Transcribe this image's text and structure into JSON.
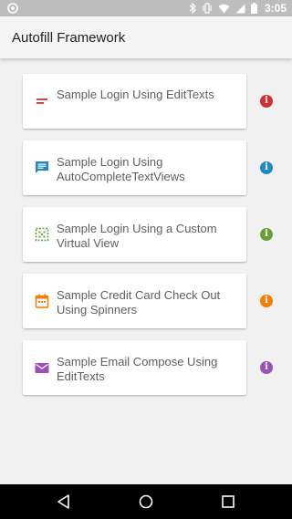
{
  "status": {
    "time": "3:05",
    "icons": [
      "bluetooth-icon",
      "vibrate-icon",
      "wifi-icon",
      "signal-icon",
      "battery-icon"
    ]
  },
  "app_bar": {
    "title": "Autofill Framework"
  },
  "items": [
    {
      "label": "Sample Login Using EditTexts",
      "icon": "text-lines-icon",
      "color": "#d32f2f"
    },
    {
      "label": "Sample Login Using AutoCompleteTextViews",
      "icon": "chat-bubble-icon",
      "color": "#1e88c9"
    },
    {
      "label": "Sample Login Using a Custom Virtual View",
      "icon": "dashed-grid-icon",
      "color": "#689f38"
    },
    {
      "label": "Sample Credit Card Check Out Using Spinners",
      "icon": "calendar-icon",
      "color": "#f57c00"
    },
    {
      "label": "Sample Email Compose Using EditTexts",
      "icon": "email-icon",
      "color": "#9c4fb8"
    }
  ],
  "nav": {
    "buttons": [
      "back-icon",
      "home-icon",
      "recents-icon"
    ]
  }
}
